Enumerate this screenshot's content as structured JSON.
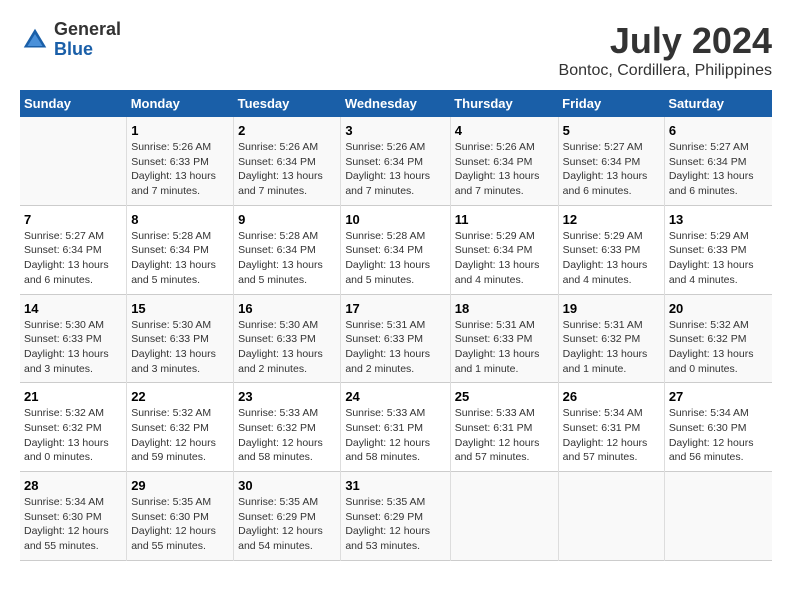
{
  "header": {
    "logo_general": "General",
    "logo_blue": "Blue",
    "month_year": "July 2024",
    "location": "Bontoc, Cordillera, Philippines"
  },
  "calendar": {
    "days_of_week": [
      "Sunday",
      "Monday",
      "Tuesday",
      "Wednesday",
      "Thursday",
      "Friday",
      "Saturday"
    ],
    "weeks": [
      [
        {
          "num": "",
          "info": ""
        },
        {
          "num": "1",
          "info": "Sunrise: 5:26 AM\nSunset: 6:33 PM\nDaylight: 13 hours\nand 7 minutes."
        },
        {
          "num": "2",
          "info": "Sunrise: 5:26 AM\nSunset: 6:34 PM\nDaylight: 13 hours\nand 7 minutes."
        },
        {
          "num": "3",
          "info": "Sunrise: 5:26 AM\nSunset: 6:34 PM\nDaylight: 13 hours\nand 7 minutes."
        },
        {
          "num": "4",
          "info": "Sunrise: 5:26 AM\nSunset: 6:34 PM\nDaylight: 13 hours\nand 7 minutes."
        },
        {
          "num": "5",
          "info": "Sunrise: 5:27 AM\nSunset: 6:34 PM\nDaylight: 13 hours\nand 6 minutes."
        },
        {
          "num": "6",
          "info": "Sunrise: 5:27 AM\nSunset: 6:34 PM\nDaylight: 13 hours\nand 6 minutes."
        }
      ],
      [
        {
          "num": "7",
          "info": "Sunrise: 5:27 AM\nSunset: 6:34 PM\nDaylight: 13 hours\nand 6 minutes."
        },
        {
          "num": "8",
          "info": "Sunrise: 5:28 AM\nSunset: 6:34 PM\nDaylight: 13 hours\nand 5 minutes."
        },
        {
          "num": "9",
          "info": "Sunrise: 5:28 AM\nSunset: 6:34 PM\nDaylight: 13 hours\nand 5 minutes."
        },
        {
          "num": "10",
          "info": "Sunrise: 5:28 AM\nSunset: 6:34 PM\nDaylight: 13 hours\nand 5 minutes."
        },
        {
          "num": "11",
          "info": "Sunrise: 5:29 AM\nSunset: 6:34 PM\nDaylight: 13 hours\nand 4 minutes."
        },
        {
          "num": "12",
          "info": "Sunrise: 5:29 AM\nSunset: 6:33 PM\nDaylight: 13 hours\nand 4 minutes."
        },
        {
          "num": "13",
          "info": "Sunrise: 5:29 AM\nSunset: 6:33 PM\nDaylight: 13 hours\nand 4 minutes."
        }
      ],
      [
        {
          "num": "14",
          "info": "Sunrise: 5:30 AM\nSunset: 6:33 PM\nDaylight: 13 hours\nand 3 minutes."
        },
        {
          "num": "15",
          "info": "Sunrise: 5:30 AM\nSunset: 6:33 PM\nDaylight: 13 hours\nand 3 minutes."
        },
        {
          "num": "16",
          "info": "Sunrise: 5:30 AM\nSunset: 6:33 PM\nDaylight: 13 hours\nand 2 minutes."
        },
        {
          "num": "17",
          "info": "Sunrise: 5:31 AM\nSunset: 6:33 PM\nDaylight: 13 hours\nand 2 minutes."
        },
        {
          "num": "18",
          "info": "Sunrise: 5:31 AM\nSunset: 6:33 PM\nDaylight: 13 hours\nand 1 minute."
        },
        {
          "num": "19",
          "info": "Sunrise: 5:31 AM\nSunset: 6:32 PM\nDaylight: 13 hours\nand 1 minute."
        },
        {
          "num": "20",
          "info": "Sunrise: 5:32 AM\nSunset: 6:32 PM\nDaylight: 13 hours\nand 0 minutes."
        }
      ],
      [
        {
          "num": "21",
          "info": "Sunrise: 5:32 AM\nSunset: 6:32 PM\nDaylight: 13 hours\nand 0 minutes."
        },
        {
          "num": "22",
          "info": "Sunrise: 5:32 AM\nSunset: 6:32 PM\nDaylight: 12 hours\nand 59 minutes."
        },
        {
          "num": "23",
          "info": "Sunrise: 5:33 AM\nSunset: 6:32 PM\nDaylight: 12 hours\nand 58 minutes."
        },
        {
          "num": "24",
          "info": "Sunrise: 5:33 AM\nSunset: 6:31 PM\nDaylight: 12 hours\nand 58 minutes."
        },
        {
          "num": "25",
          "info": "Sunrise: 5:33 AM\nSunset: 6:31 PM\nDaylight: 12 hours\nand 57 minutes."
        },
        {
          "num": "26",
          "info": "Sunrise: 5:34 AM\nSunset: 6:31 PM\nDaylight: 12 hours\nand 57 minutes."
        },
        {
          "num": "27",
          "info": "Sunrise: 5:34 AM\nSunset: 6:30 PM\nDaylight: 12 hours\nand 56 minutes."
        }
      ],
      [
        {
          "num": "28",
          "info": "Sunrise: 5:34 AM\nSunset: 6:30 PM\nDaylight: 12 hours\nand 55 minutes."
        },
        {
          "num": "29",
          "info": "Sunrise: 5:35 AM\nSunset: 6:30 PM\nDaylight: 12 hours\nand 55 minutes."
        },
        {
          "num": "30",
          "info": "Sunrise: 5:35 AM\nSunset: 6:29 PM\nDaylight: 12 hours\nand 54 minutes."
        },
        {
          "num": "31",
          "info": "Sunrise: 5:35 AM\nSunset: 6:29 PM\nDaylight: 12 hours\nand 53 minutes."
        },
        {
          "num": "",
          "info": ""
        },
        {
          "num": "",
          "info": ""
        },
        {
          "num": "",
          "info": ""
        }
      ]
    ]
  }
}
